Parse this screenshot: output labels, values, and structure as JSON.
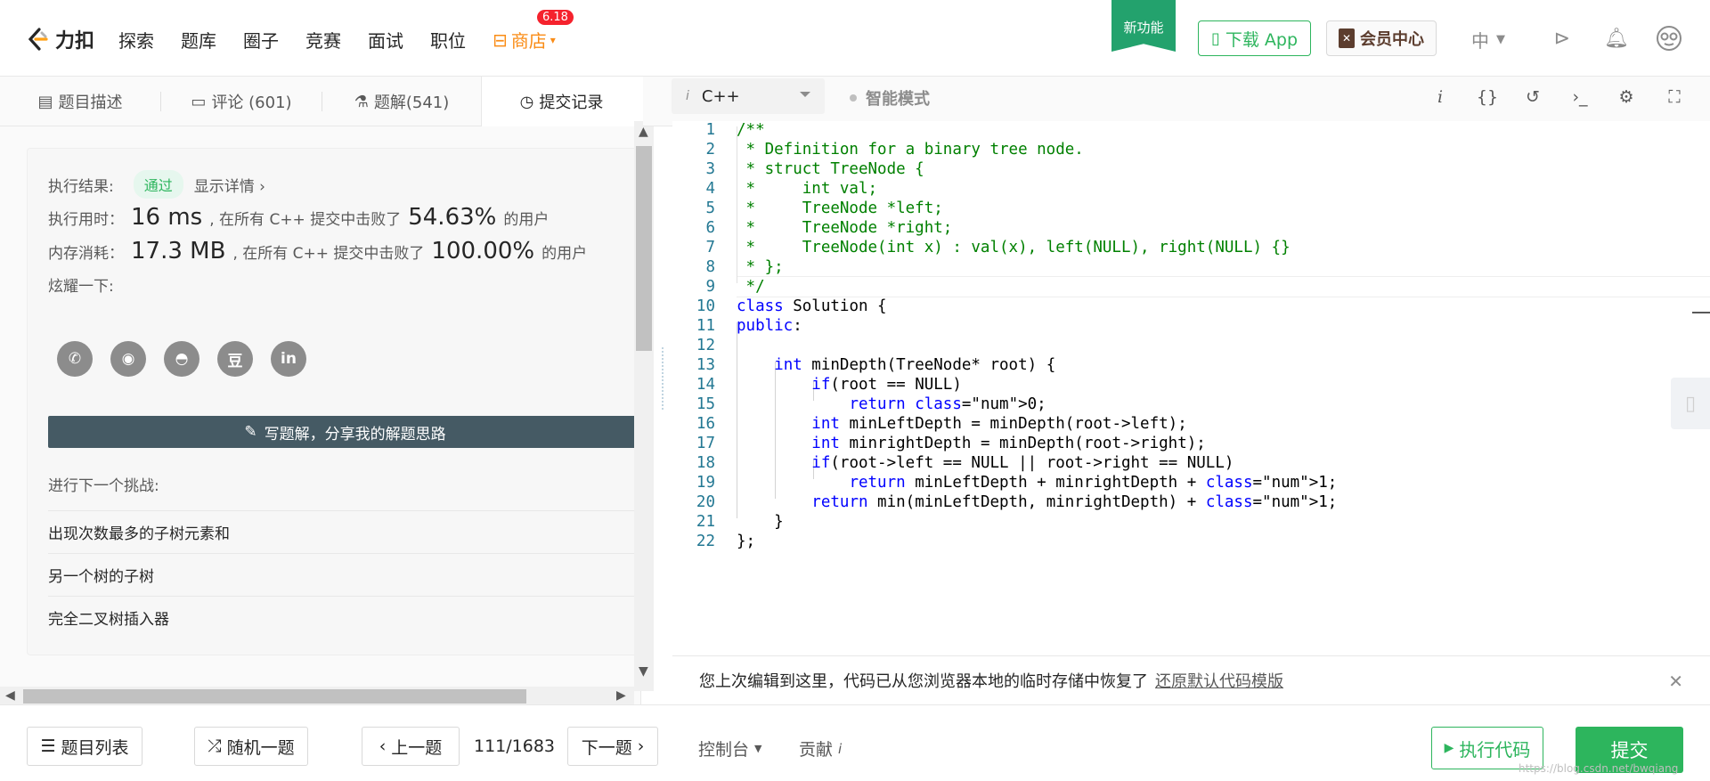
{
  "nav": {
    "brand": "力扣",
    "items": [
      "探索",
      "题库",
      "圈子",
      "竞赛",
      "面试",
      "职位"
    ],
    "shop_label": "商店",
    "shop_badge": "6.18",
    "new_feature": "新功能",
    "download_app": "下载 App",
    "vip_center": "会员中心",
    "language": "中"
  },
  "left_tabs": {
    "description": "题目描述",
    "comments": "评论 (601)",
    "solutions": "题解(541)",
    "submissions": "提交记录"
  },
  "result": {
    "exec_label": "执行结果:",
    "status": "通过",
    "details_link": "显示详情 ›",
    "time_label": "执行用时：",
    "time_value": "16 ms",
    "time_mid": ", 在所有 C++ 提交中击败了",
    "time_percent": "54.63%",
    "time_suffix": "的用户",
    "mem_label": "内存消耗：",
    "mem_value": "17.3 MB",
    "mem_mid": ", 在所有 C++ 提交中击败了",
    "mem_percent": "100.00%",
    "mem_suffix": "的用户",
    "share_label": "炫耀一下:",
    "share_icons": [
      {
        "name": "wechat-icon",
        "glyph": "✆"
      },
      {
        "name": "weibo-icon",
        "glyph": "◉"
      },
      {
        "name": "qq-icon",
        "glyph": "◓"
      },
      {
        "name": "douban-icon",
        "glyph": "豆"
      },
      {
        "name": "linkedin-icon",
        "glyph": "in"
      }
    ],
    "write_solution": "写题解，分享我的解题思路",
    "next_label": "进行下一个挑战:",
    "challenges": [
      "出现次数最多的子树元素和",
      "另一个树的子树",
      "完全二叉树插入器"
    ]
  },
  "editor": {
    "language": "C++",
    "smart_mode": "智能模式",
    "lines": [
      "/**",
      " * Definition for a binary tree node.",
      " * struct TreeNode {",
      " *     int val;",
      " *     TreeNode *left;",
      " *     TreeNode *right;",
      " *     TreeNode(int x) : val(x), left(NULL), right(NULL) {}",
      " * };",
      " */",
      "class Solution {",
      "public:",
      "",
      "    int minDepth(TreeNode* root) {",
      "        if(root == NULL)",
      "            return 0;",
      "        int minLeftDepth = minDepth(root->left);",
      "        int minrightDepth = minDepth(root->right);",
      "        if(root->left == NULL || root->right == NULL)",
      "            return minLeftDepth + minrightDepth + 1;",
      "        return min(minLeftDepth, minrightDepth) + 1;",
      "    }",
      "};"
    ],
    "notice_text": "您上次编辑到这里，代码已从您浏览器本地的临时存储中恢复了",
    "notice_link": "还原默认代码模版"
  },
  "bottom": {
    "problem_list": "题目列表",
    "random": "随机一题",
    "prev": "上一题",
    "progress": "111/1683",
    "next": "下一题",
    "console": "控制台",
    "contribute": "贡献",
    "run": "执行代码",
    "submit": "提交",
    "watermark": "https://blog.csdn.net/bwqiang"
  },
  "colors": {
    "accent_green": "#2db55d",
    "shop_orange": "#fa8c16",
    "badge_red": "#f5222d",
    "write_btn": "#455a64"
  }
}
